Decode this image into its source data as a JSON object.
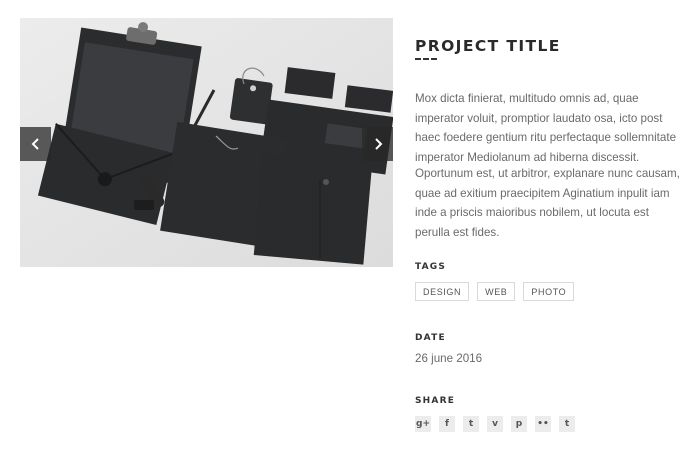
{
  "project": {
    "title": "PROJECT TITLE",
    "description": [
      "Mox dicta finierat, multitudo omnis ad, quae imperator voluit, promptior laudato osa, icto post haec foedere gentium ritu perfectaque sollemnitate imperator Mediolanum ad hiberna discessit.",
      "Oportunum est, ut arbitror, explanare nunc causam, quae ad exitium praecipitem Aginatium inpulit iam inde a priscis maioribus nobilem, ut locuta est perulla est fides."
    ]
  },
  "tags": {
    "label": "TAGS",
    "items": [
      "DESIGN",
      "WEB",
      "PHOTO"
    ]
  },
  "date": {
    "label": "DATE",
    "value": "26 june 2016"
  },
  "share": {
    "label": "SHARE",
    "items": [
      {
        "icon": "google-plus-icon",
        "glyph": "g+"
      },
      {
        "icon": "facebook-icon",
        "glyph": "f"
      },
      {
        "icon": "twitter-icon",
        "glyph": "t"
      },
      {
        "icon": "vimeo-icon",
        "glyph": "v"
      },
      {
        "icon": "pinterest-icon",
        "glyph": "p"
      },
      {
        "icon": "flickr-icon",
        "glyph": "••"
      },
      {
        "icon": "tumblr-icon",
        "glyph": "t"
      }
    ]
  },
  "slider": {
    "image": "black-stationery-mockup-photo",
    "prev_icon": "chevron-left-icon",
    "next_icon": "chevron-right-icon"
  }
}
